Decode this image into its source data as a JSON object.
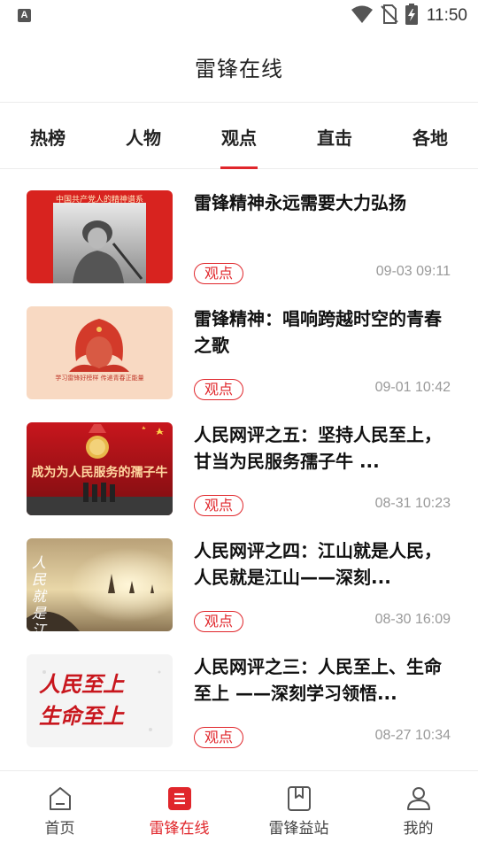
{
  "status_bar": {
    "app_glyph": "A",
    "time": "11:50",
    "icons": [
      "wifi-icon",
      "no-sim-icon",
      "battery-charging-icon"
    ]
  },
  "header": {
    "title": "雷锋在线"
  },
  "tabs": [
    {
      "label": "热榜",
      "active": false
    },
    {
      "label": "人物",
      "active": false
    },
    {
      "label": "观点",
      "active": true
    },
    {
      "label": "直击",
      "active": false
    },
    {
      "label": "各地",
      "active": false
    }
  ],
  "articles": [
    {
      "title": "雷锋精神永远需要大力弘扬",
      "tag": "观点",
      "date": "09-03 09:11",
      "thumb_caption": "中国共产党人的精神谱系"
    },
    {
      "title": "雷锋精神：唱响跨越时空的青春之歌",
      "tag": "观点",
      "date": "09-01 10:42",
      "thumb_caption": "学习雷锋好榜样 传递青春正能量"
    },
    {
      "title": "人民网评之五：坚持人民至上，甘当为民服务孺子牛 ...",
      "tag": "观点",
      "date": "08-31 10:23",
      "thumb_caption": "成为为人民服务的孺子牛"
    },
    {
      "title": "人民网评之四：江山就是人民，人民就是江山——深刻...",
      "tag": "观点",
      "date": "08-30 16:09",
      "thumb_caption": "人民就是江山"
    },
    {
      "title": "人民网评之三：人民至上、生命至上 ——深刻学习领悟...",
      "tag": "观点",
      "date": "08-27 10:34",
      "thumb_caption": "人民至上 生命至上"
    }
  ],
  "colors": {
    "accent": "#e0262b",
    "text": "#111111",
    "muted": "#999999"
  },
  "bottom_nav": [
    {
      "label": "首页",
      "icon": "home-icon",
      "active": false
    },
    {
      "label": "雷锋在线",
      "icon": "document-list-icon",
      "active": true
    },
    {
      "label": "雷锋益站",
      "icon": "bookmark-book-icon",
      "active": false
    },
    {
      "label": "我的",
      "icon": "user-icon",
      "active": false
    }
  ]
}
